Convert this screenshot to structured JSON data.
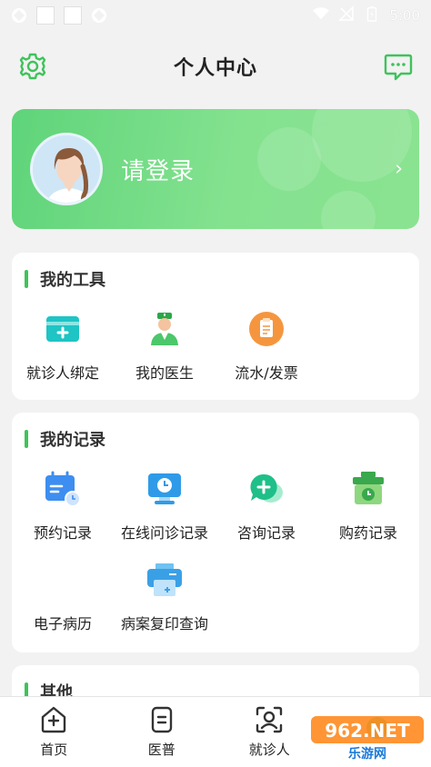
{
  "status_bar": {
    "time": "5:00"
  },
  "header": {
    "title": "个人中心"
  },
  "login": {
    "text": "请登录"
  },
  "tools": {
    "title": "我的工具",
    "items": [
      {
        "label": "就诊人绑定",
        "icon": "patient-card-icon"
      },
      {
        "label": "我的医生",
        "icon": "doctor-icon"
      },
      {
        "label": "流水/发票",
        "icon": "invoice-icon"
      }
    ]
  },
  "records": {
    "title": "我的记录",
    "items": [
      {
        "label": "预约记录",
        "icon": "calendar-icon"
      },
      {
        "label": "在线问诊记录",
        "icon": "monitor-clock-icon"
      },
      {
        "label": "咨询记录",
        "icon": "chat-plus-icon"
      },
      {
        "label": "购药记录",
        "icon": "medicine-basket-icon"
      },
      {
        "label": "电子病历",
        "icon": "medical-record-icon"
      },
      {
        "label": "病案复印查询",
        "icon": "printer-icon"
      }
    ]
  },
  "other": {
    "title": "其他"
  },
  "nav": {
    "items": [
      {
        "label": "首页"
      },
      {
        "label": "医普"
      },
      {
        "label": "就诊人"
      },
      {
        "label": ""
      }
    ]
  },
  "watermark": {
    "text": "962.NET",
    "subtext": "乐游网"
  },
  "colors": {
    "accent": "#3ec35a",
    "card_gradient_start": "#5fd47a",
    "card_gradient_end": "#8ae391"
  }
}
